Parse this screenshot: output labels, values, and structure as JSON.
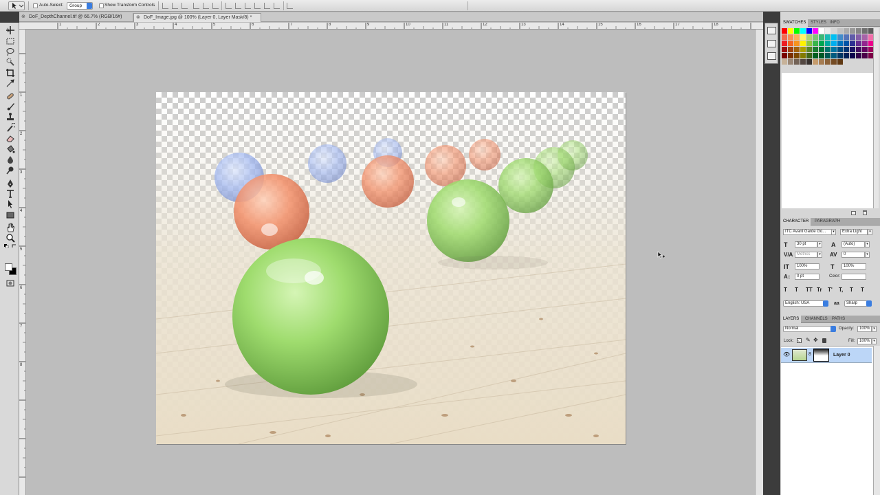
{
  "options_bar": {
    "auto_select_label": "Auto-Select:",
    "auto_select_value": "Group",
    "show_transform_label": "Show Transform Controls"
  },
  "tabs": [
    {
      "label": "DoF_DepthChannel.tif @ 66.7% (RGB/16#)",
      "active": false
    },
    {
      "label": "DoF_Image.jpg @ 100% (Layer 0, Layer Mask/8) *",
      "active": true
    }
  ],
  "ruler": {
    "top": [
      "1",
      "2",
      "3",
      "4",
      "5",
      "6",
      "7",
      "8",
      "9",
      "10",
      "11",
      "12",
      "13",
      "14",
      "15",
      "16",
      "17",
      "18"
    ],
    "left": [
      "1",
      "2",
      "3",
      "4",
      "5",
      "6",
      "7",
      "8"
    ]
  },
  "swatches_panel": {
    "tabs": [
      "SWATCHES",
      "STYLES",
      "INFO"
    ],
    "colors": [
      "#ff0000",
      "#ffff00",
      "#00ff00",
      "#00ffff",
      "#0000ff",
      "#ff00ff",
      "#ffffff",
      "#ebebeb",
      "#d6d6d6",
      "#c2c2c2",
      "#adadad",
      "#999999",
      "#858585",
      "#707070",
      "#5c5c5c",
      "#f26c4f",
      "#f68e55",
      "#fbaf5c",
      "#fff467",
      "#acd372",
      "#7cc576",
      "#3bb878",
      "#1abbb4",
      "#00bff3",
      "#438cca",
      "#5574b9",
      "#605ca8",
      "#855fa8",
      "#a763a8",
      "#f06ea9",
      "#ed1c24",
      "#f26522",
      "#f7941d",
      "#fff200",
      "#8dc63f",
      "#39b54a",
      "#00a651",
      "#00a99d",
      "#00aeef",
      "#0072bc",
      "#0054a6",
      "#2e3192",
      "#662d91",
      "#92278f",
      "#ec008c",
      "#9e0b0f",
      "#a0410d",
      "#a36209",
      "#aba000",
      "#598527",
      "#1a7b30",
      "#007236",
      "#00746b",
      "#0076a3",
      "#004b80",
      "#003471",
      "#1b1464",
      "#440e62",
      "#630460",
      "#9e005d",
      "#790000",
      "#7b2e00",
      "#7d4900",
      "#827b00",
      "#406618",
      "#005e20",
      "#005826",
      "#005952",
      "#005b7f",
      "#003663",
      "#002157",
      "#0d004c",
      "#32004b",
      "#4b0049",
      "#7b0046",
      "#c7b299",
      "#998675",
      "#736357",
      "#534741",
      "#37302d",
      "#c69c6d",
      "#a67c52",
      "#8c6239",
      "#754c24",
      "#603913"
    ],
    "footer_icons": [
      "new-swatch-icon",
      "trash-icon"
    ]
  },
  "character_panel": {
    "tabs": [
      "CHARACTER",
      "PARAGRAPH"
    ],
    "font_family": "ITC Avant Garde Go...",
    "font_style": "Extra Light",
    "font_size": "30 pt",
    "leading": "(Auto)",
    "kerning": "Metrics",
    "tracking": "0",
    "vertical_scale": "100%",
    "horizontal_scale": "100%",
    "baseline_shift": "0 pt",
    "color_label": "Color:",
    "style_buttons": [
      "T",
      "T",
      "TT",
      "Tr",
      "T'",
      "T,",
      "T",
      "T"
    ],
    "language": "English: USA",
    "aa_label": "aa",
    "antialias": "Sharp"
  },
  "layers_panel": {
    "tabs": [
      "LAYERS",
      "CHANNELS",
      "PATHS"
    ],
    "blend_mode": "Normal",
    "opacity_label": "Opacity:",
    "opacity": "100%",
    "lock_label": "Lock:",
    "fill_label": "Fill:",
    "fill": "100%",
    "layers": [
      {
        "name": "Layer 0",
        "visible": true,
        "has_mask": true,
        "selected": true
      }
    ]
  },
  "colors": {
    "selection_blue": "#bcd6f7",
    "accent_blue": "#3a7de0",
    "dock_dark": "#3c3c3c"
  }
}
